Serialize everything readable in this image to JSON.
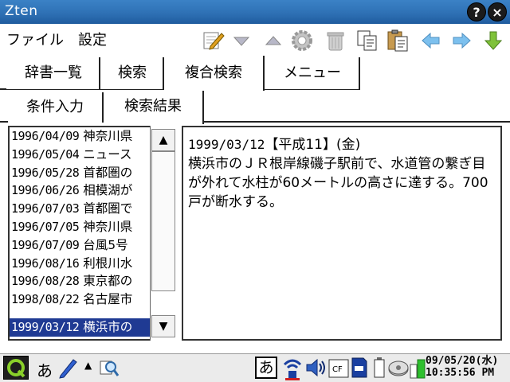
{
  "window": {
    "title": "Zten"
  },
  "titlebar": {
    "help_glyph": "?",
    "close_glyph": "×"
  },
  "menu": {
    "items": [
      "ファイル",
      "設定"
    ]
  },
  "toolbar": {
    "icons": [
      "edit-icon",
      "dropdown-icon",
      "up-triangle-icon",
      "gear-icon",
      "trash-icon",
      "copy-icon",
      "paste-icon",
      "back-arrow-icon",
      "forward-arrow-icon",
      "download-arrow-icon"
    ]
  },
  "tabs": {
    "main": [
      "辞書一覧",
      "検索",
      "複合検索",
      "メニュー"
    ],
    "active_main": 2,
    "sub": [
      "条件入力",
      "検索結果"
    ],
    "active_sub": 1
  },
  "results": {
    "rows": [
      {
        "date": "1996/04/09",
        "text": "神奈川県"
      },
      {
        "date": "1996/05/04",
        "text": "ニュース"
      },
      {
        "date": "1996/05/28",
        "text": "首都圏の"
      },
      {
        "date": "1996/06/26",
        "text": "相模湖が"
      },
      {
        "date": "1996/07/03",
        "text": "首都圏で"
      },
      {
        "date": "1996/07/05",
        "text": "神奈川県"
      },
      {
        "date": "1996/07/09",
        "text": "台風5号"
      },
      {
        "date": "1996/08/16",
        "text": "利根川水"
      },
      {
        "date": "1996/08/28",
        "text": "東京都の"
      },
      {
        "date": "1998/08/22",
        "text": "名古屋市"
      },
      {
        "date": "1999/03/12",
        "text": "横浜市の"
      }
    ],
    "selected_index": 10
  },
  "detail": {
    "header_date": "1999/03/12",
    "header_era": "【平成11】(金)",
    "body": "横浜市のＪＲ根岸線磯子駅前で、水道管の繋ぎ目が外れて水柱が60メートルの高さに達する。700戸が断水する。"
  },
  "taskbar": {
    "ime_char": "あ",
    "ime_box_char": "あ",
    "date": "09/05/20(水)",
    "time": "10:35:56 PM"
  },
  "colors": {
    "titlebar": "#2d6fb3",
    "selection": "#1f3a93",
    "arrow_blue": "#4fa3e0",
    "arrow_green": "#5aa02c"
  }
}
